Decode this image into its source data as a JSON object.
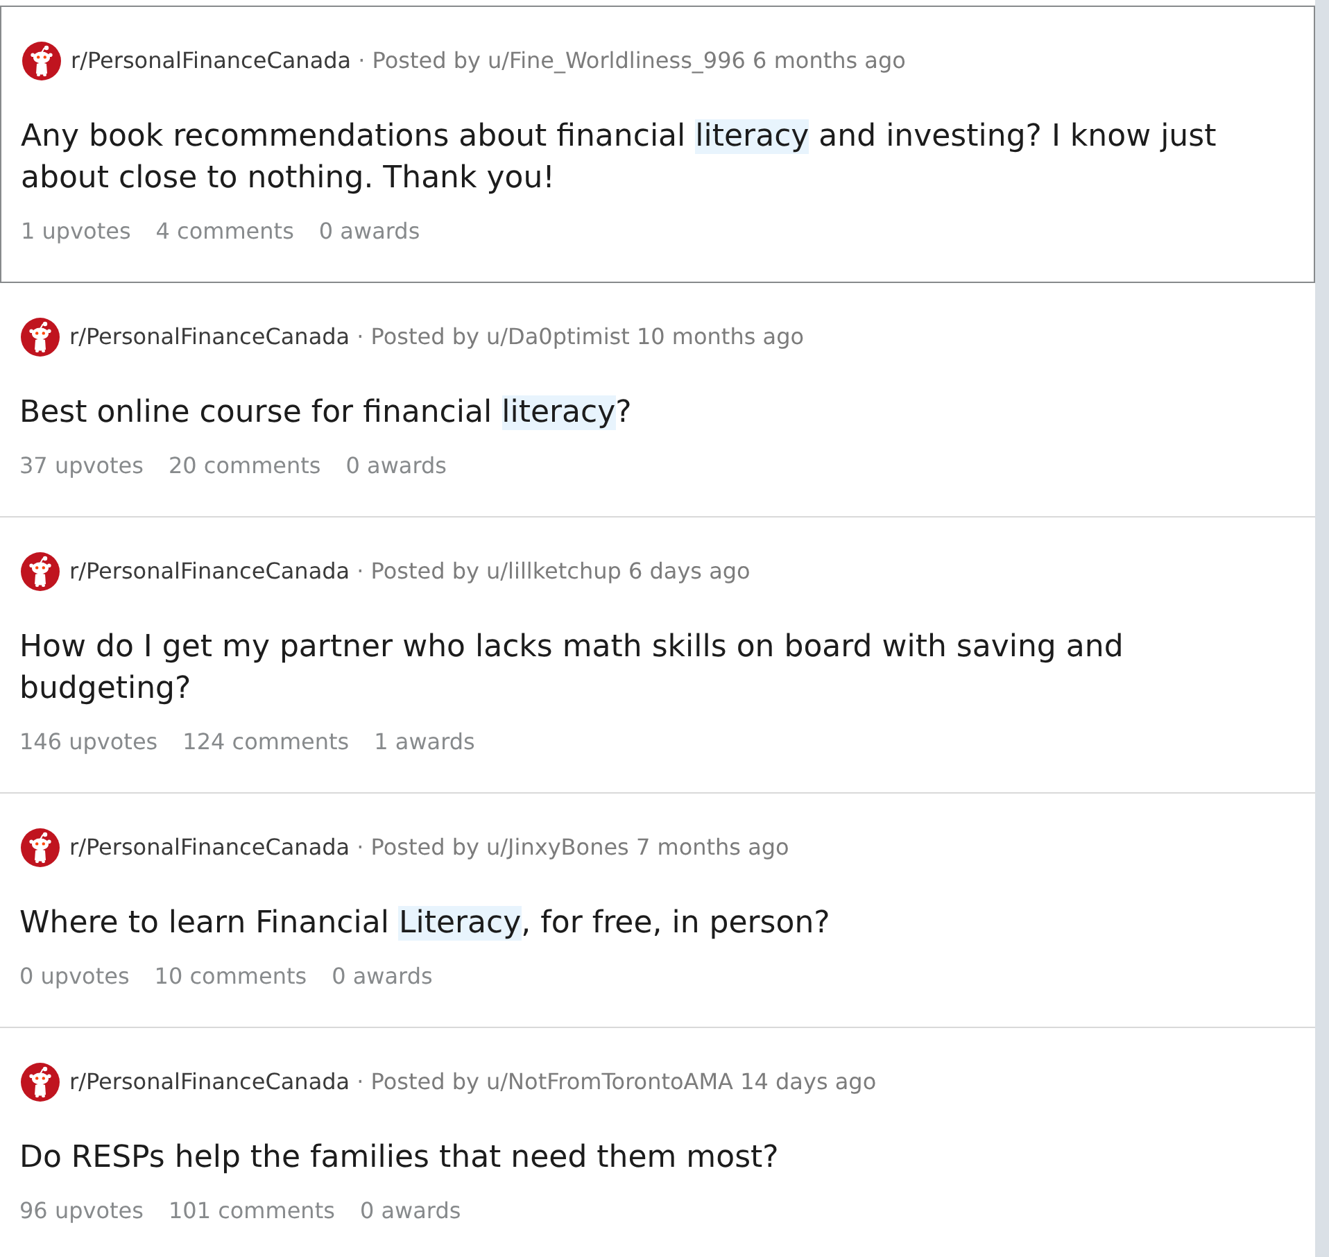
{
  "posts": [
    {
      "subreddit": "r/PersonalFinanceCanada",
      "byline": "· Posted by u/Fine_Worldliness_996 6 months ago",
      "title": [
        {
          "text": "Any book recommendations about financial ",
          "highlight": false
        },
        {
          "text": "literacy",
          "highlight": true
        },
        {
          "text": " and investing? I know just about close to nothing. Thank you!",
          "highlight": false
        }
      ],
      "upvotes": "1 upvotes",
      "comments": "4 comments",
      "awards": "0 awards",
      "selected": true
    },
    {
      "subreddit": "r/PersonalFinanceCanada",
      "byline": "· Posted by u/Da0ptimist 10 months ago",
      "title": [
        {
          "text": "Best online course for financial ",
          "highlight": false
        },
        {
          "text": "literacy",
          "highlight": true
        },
        {
          "text": "?",
          "highlight": false
        }
      ],
      "upvotes": "37 upvotes",
      "comments": "20 comments",
      "awards": "0 awards",
      "selected": false
    },
    {
      "subreddit": "r/PersonalFinanceCanada",
      "byline": "· Posted by u/lillketchup 6 days ago",
      "title": [
        {
          "text": "How do I get my partner who lacks math skills on board with saving and budgeting?",
          "highlight": false
        }
      ],
      "upvotes": "146 upvotes",
      "comments": "124 comments",
      "awards": "1 awards",
      "selected": false
    },
    {
      "subreddit": "r/PersonalFinanceCanada",
      "byline": "· Posted by u/JinxyBones 7 months ago",
      "title": [
        {
          "text": "Where to learn Financial ",
          "highlight": false
        },
        {
          "text": "Literacy",
          "highlight": true
        },
        {
          "text": ", for free, in person?",
          "highlight": false
        }
      ],
      "upvotes": "0 upvotes",
      "comments": "10 comments",
      "awards": "0 awards",
      "selected": false
    },
    {
      "subreddit": "r/PersonalFinanceCanada",
      "byline": "· Posted by u/NotFromTorontoAMA 14 days ago",
      "title": [
        {
          "text": "Do RESPs help the families that need them most?",
          "highlight": false
        }
      ],
      "upvotes": "96 upvotes",
      "comments": "101 comments",
      "awards": "0 awards",
      "selected": false
    }
  ]
}
